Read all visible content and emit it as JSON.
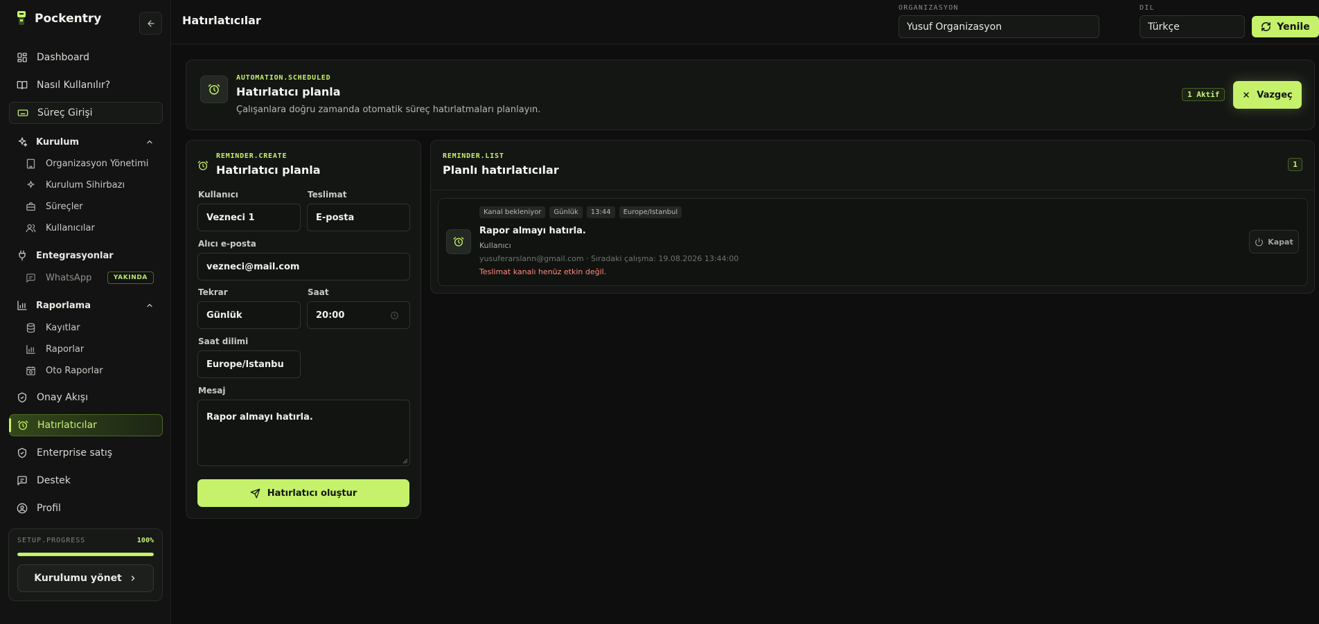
{
  "app": {
    "name": "Pockentry"
  },
  "colors": {
    "accent": "#c5f26a",
    "background": "#0d0e0d",
    "warning": "#ff8a7a"
  },
  "sidebar": {
    "top_items": [
      {
        "label": "Dashboard",
        "icon": "grid-icon"
      },
      {
        "label": "Nasıl Kullanılır?",
        "icon": "book-icon"
      },
      {
        "label": "Süreç Girişi",
        "icon": "keyboard-icon"
      }
    ],
    "sections": {
      "kurulum": {
        "label": "Kurulum",
        "items": [
          {
            "label": "Organizasyon Yönetimi",
            "icon": "building-icon"
          },
          {
            "label": "Kurulum Sihirbazı",
            "icon": "sparkles-icon"
          },
          {
            "label": "Süreçler",
            "icon": "briefcase-icon"
          },
          {
            "label": "Kullanıcılar",
            "icon": "users-icon"
          }
        ]
      },
      "entegrasyonlar": {
        "label": "Entegrasyonlar",
        "items": [
          {
            "label": "WhatsApp",
            "icon": "chat-icon",
            "badge": "YAKINDA"
          }
        ]
      },
      "raporlama": {
        "label": "Raporlama",
        "items": [
          {
            "label": "Kayıtlar",
            "icon": "database-icon"
          },
          {
            "label": "Raporlar",
            "icon": "bar-chart-icon"
          },
          {
            "label": "Oto Raporlar",
            "icon": "calendar-clock-icon"
          }
        ]
      }
    },
    "bottom_items": [
      {
        "label": "Onay Akışı",
        "icon": "shield-check-icon"
      },
      {
        "label": "Hatırlatıcılar",
        "icon": "alarm-icon",
        "active": true
      },
      {
        "label": "Enterprise satış",
        "icon": "shield-check-icon"
      },
      {
        "label": "Destek",
        "icon": "message-icon"
      },
      {
        "label": "Profil",
        "icon": "user-circle-icon"
      }
    ],
    "setup": {
      "label": "SETUP.PROGRESS",
      "percent_text": "100%",
      "progress": 1.0,
      "button_label": "Kurulumu yönet"
    }
  },
  "header": {
    "title": "Hatırlatıcılar",
    "organization_label": "ORGANIZASYON",
    "organization_value": "Yusuf Organizasyon",
    "language_label": "DIL",
    "language_value": "Türkçe",
    "refresh_label": "Yenile"
  },
  "banner": {
    "kicker": "AUTOMATION.SCHEDULED",
    "title": "Hatırlatıcı planla",
    "description": "Çalışanlara doğru zamanda otomatik süreç hatırlatmaları planlayın.",
    "active_badge": "1 Aktif",
    "cancel_label": "Vazgeç"
  },
  "form": {
    "kicker": "REMINDER.CREATE",
    "title": "Hatırlatıcı planla",
    "user_label": "Kullanıcı",
    "user_value": "Vezneci 1",
    "delivery_label": "Teslimat",
    "delivery_value": "E-posta",
    "email_label": "Alıcı e-posta",
    "email_value": "vezneci@mail.com",
    "repeat_label": "Tekrar",
    "repeat_value": "Günlük",
    "time_label": "Saat",
    "time_value": "20:00",
    "timezone_label": "Saat dilimi",
    "timezone_value": "Europe/Istanbu",
    "message_label": "Mesaj",
    "message_value": "Rapor almayı hatırla.",
    "submit_label": "Hatırlatıcı oluştur"
  },
  "list": {
    "kicker": "REMINDER.LIST",
    "title": "Planlı hatırlatıcılar",
    "count": "1",
    "items": [
      {
        "chips": [
          "Kanal bekleniyor",
          "Günlük",
          "13:44",
          "Europe/Istanbul"
        ],
        "title": "Rapor almayı hatırla.",
        "target": "Kullanıcı",
        "meta": "yusuferarslann@gmail.com · Sıradaki çalışma: 19.08.2026 13:44:00",
        "warning": "Teslimat kanalı henüz etkin değil.",
        "close_label": "Kapat"
      }
    ]
  }
}
